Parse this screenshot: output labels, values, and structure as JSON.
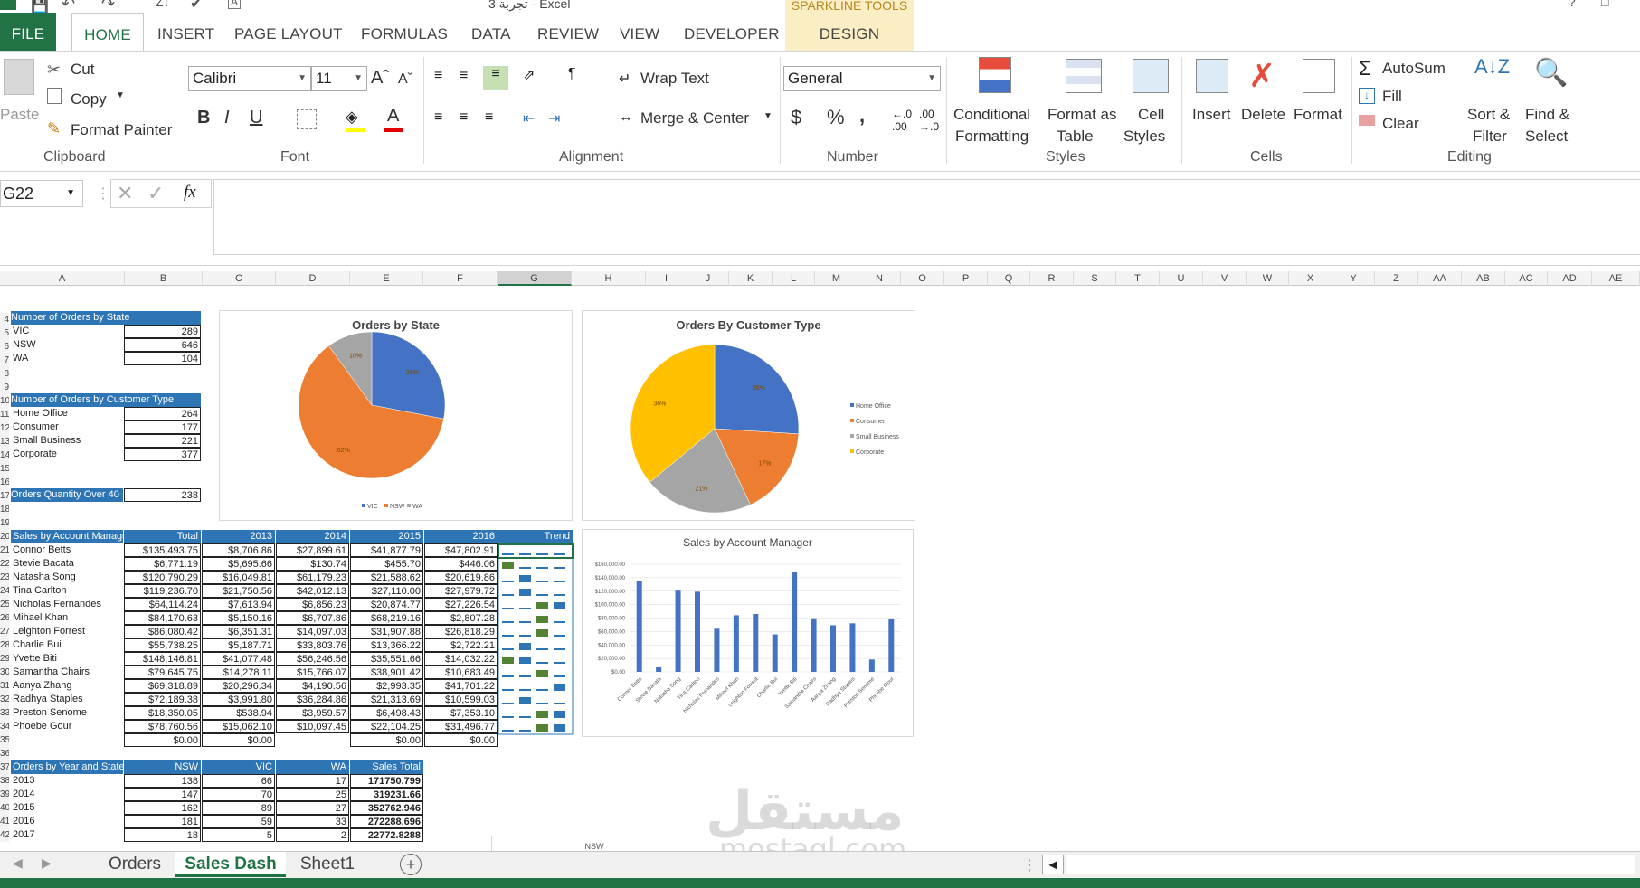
{
  "window": {
    "title": "تجربة 3 - Excel",
    "context_label": "SPARKLINE TOOLS"
  },
  "tabs": [
    "FILE",
    "HOME",
    "INSERT",
    "PAGE LAYOUT",
    "FORMULAS",
    "DATA",
    "REVIEW",
    "VIEW",
    "DEVELOPER"
  ],
  "context_tab": "DESIGN",
  "ribbon": {
    "clipboard": {
      "paste": "Paste",
      "cut": "Cut",
      "copy": "Copy",
      "format_painter": "Format Painter",
      "label": "Clipboard"
    },
    "font": {
      "name": "Calibri",
      "size": "11",
      "bold": "B",
      "italic": "I",
      "underline": "U",
      "label": "Font"
    },
    "alignment": {
      "wrap": "Wrap Text",
      "merge": "Merge & Center",
      "label": "Alignment"
    },
    "number": {
      "format": "General",
      "currency": "$",
      "percent": "%",
      "comma": ",",
      "label": "Number"
    },
    "styles": {
      "cond1": "Conditional",
      "cond2": "Formatting",
      "fmt1": "Format as",
      "fmt2": "Table",
      "cell1": "Cell",
      "cell2": "Styles",
      "label": "Styles"
    },
    "cells": {
      "insert": "Insert",
      "delete": "Delete",
      "format": "Format",
      "label": "Cells"
    },
    "editing": {
      "autosum": "AutoSum",
      "fill": "Fill",
      "clear": "Clear",
      "sort1": "Sort &",
      "sort2": "Filter",
      "find1": "Find &",
      "find2": "Select",
      "label": "Editing"
    }
  },
  "formula_bar": {
    "name_box": "G22",
    "fx": "fx",
    "value": ""
  },
  "columns": [
    "A",
    "B",
    "C",
    "D",
    "E",
    "F",
    "G",
    "H",
    "I",
    "J",
    "K",
    "L",
    "M",
    "N",
    "O",
    "P",
    "Q",
    "R",
    "S",
    "T",
    "U",
    "V",
    "W",
    "X",
    "Y",
    "Z",
    "AA",
    "AB",
    "AC",
    "AD",
    "AE"
  ],
  "tables": {
    "state": {
      "header": "Number of Orders by State",
      "rows": [
        [
          "VIC",
          "289"
        ],
        [
          "NSW",
          "646"
        ],
        [
          "WA",
          "104"
        ]
      ]
    },
    "customer": {
      "header": "Number of Orders by Customer Type",
      "rows": [
        [
          "Home Office",
          "264"
        ],
        [
          "Consumer",
          "177"
        ],
        [
          "Small Business",
          "221"
        ],
        [
          "Corporate",
          "377"
        ]
      ]
    },
    "qty": {
      "label": "Orders Quantity Over 40",
      "value": "238"
    },
    "managers": {
      "headers": [
        "Sales by Account Manager",
        "Total",
        "2013",
        "2014",
        "2015",
        "2016",
        "Trend"
      ],
      "rows": [
        [
          "Connor Betts",
          "$135,493.75",
          "$8,706.86",
          "$27,899.61",
          "$41,877.79",
          "$47,802.91"
        ],
        [
          "Stevie Bacata",
          "$6,771.19",
          "$5,695.66",
          "$130.74",
          "$455.70",
          "$446.06"
        ],
        [
          "Natasha Song",
          "$120,790.29",
          "$16,049.81",
          "$61,179.23",
          "$21,588.62",
          "$20,619.86"
        ],
        [
          "Tina Carlton",
          "$119,236.70",
          "$21,750.56",
          "$42,012.13",
          "$27,110.00",
          "$27,979.72"
        ],
        [
          "Nicholas Fernandes",
          "$64,114.24",
          "$7,613.94",
          "$6,856.23",
          "$20,874.77",
          "$27,226.54"
        ],
        [
          "Mihael Khan",
          "$84,170.63",
          "$5,150.16",
          "$6,707.86",
          "$68,219.16",
          "$2,807.28"
        ],
        [
          "Leighton Forrest",
          "$86,080.42",
          "$6,351.31",
          "$14,097.03",
          "$31,907.88",
          "$26,818.29"
        ],
        [
          "Charlie Bui",
          "$55,738.25",
          "$5,187.71",
          "$33,803.76",
          "$13,366.22",
          "$2,722.21"
        ],
        [
          "Yvette Biti",
          "$148,146.81",
          "$41,077.48",
          "$56,246.56",
          "$35,551.66",
          "$14,032.22"
        ],
        [
          "Samantha Chairs",
          "$79,645.75",
          "$14,278.11",
          "$15,766.07",
          "$38,901.42",
          "$10,683.49"
        ],
        [
          "Aanya Zhang",
          "$69,318.89",
          "$20,296.34",
          "$4,190.56",
          "$2,993.35",
          "$41,701.22"
        ],
        [
          "Radhya Staples",
          "$72,189.38",
          "$3,991.80",
          "$36,284.86",
          "$21,313.69",
          "$10,599.03"
        ],
        [
          "Preston Senome",
          "$18,350.05",
          "$538.94",
          "$3,959.57",
          "$6,498.43",
          "$7,353.10"
        ],
        [
          "Phoebe Gour",
          "$78,760.56",
          "$15,062.10",
          "$10,097.45",
          "$22,104.25",
          "$31,496.77"
        ],
        [
          "",
          "$0.00",
          "$0.00",
          "",
          "$0.00",
          "$0.00"
        ]
      ]
    },
    "year": {
      "headers": [
        "Orders by Year and State",
        "NSW",
        "VIC",
        "WA",
        "Sales Total"
      ],
      "rows": [
        [
          "2013",
          "138",
          "66",
          "17",
          "171750.799"
        ],
        [
          "2014",
          "147",
          "70",
          "25",
          "319231.66"
        ],
        [
          "2015",
          "162",
          "89",
          "27",
          "352762.946"
        ],
        [
          "2016",
          "181",
          "59",
          "33",
          "272288.696"
        ],
        [
          "2017",
          "18",
          "5",
          "2",
          "22772.8288"
        ]
      ]
    }
  },
  "row_numbers": [
    "4",
    "5",
    "6",
    "7",
    "8",
    "9",
    "10",
    "11",
    "12",
    "13",
    "14",
    "15",
    "16",
    "17",
    "18",
    "19",
    "20",
    "21",
    "22",
    "23",
    "24",
    "25",
    "26",
    "27",
    "28",
    "29",
    "30",
    "31",
    "32",
    "33",
    "34",
    "35",
    "36",
    "37",
    "38",
    "39",
    "40",
    "41",
    "42"
  ],
  "chart_data": [
    {
      "type": "pie",
      "title": "Orders by State",
      "categories": [
        "VIC",
        "NSW",
        "WA"
      ],
      "values": [
        28,
        62,
        10
      ],
      "labels": [
        "28%",
        "62%",
        "10%"
      ],
      "colors": [
        "#4472c4",
        "#ed7d31",
        "#a5a5a5"
      ],
      "legend": "bottom"
    },
    {
      "type": "pie",
      "title": "Orders By Customer Type",
      "categories": [
        "Home Office",
        "Consumer",
        "Small Business",
        "Corporate"
      ],
      "values": [
        26,
        17,
        21,
        36
      ],
      "labels": [
        "26%",
        "17%",
        "21%",
        "36%"
      ],
      "colors": [
        "#4472c4",
        "#ed7d31",
        "#a5a5a5",
        "#ffc000"
      ],
      "legend": "right"
    },
    {
      "type": "bar",
      "title": "Sales by Account Manager",
      "categories": [
        "Connor Betts",
        "Stevie Bacata",
        "Natasha Song",
        "Tina Carlton",
        "Nicholas Fernandes",
        "Mihael Khan",
        "Leighton Forrest",
        "Charlie Bui",
        "Yvette Biti",
        "Samantha Chairs",
        "Aanya Zhang",
        "Radhya Staples",
        "Preston Senome",
        "Phoebe Gour"
      ],
      "values": [
        135493.75,
        6771.19,
        120790.29,
        119236.7,
        64114.24,
        84170.63,
        86080.42,
        55738.25,
        148146.81,
        79645.75,
        69318.89,
        72189.38,
        18350.05,
        78760.56
      ],
      "ylim": [
        0,
        160000
      ],
      "yticks": [
        "$0.00",
        "$20,000.00",
        "$40,000.00",
        "$60,000.00",
        "$80,000.00",
        "$100,000.00",
        "$120,000.00",
        "$140,000.00",
        "$160,000.00"
      ],
      "color": "#4472c4"
    }
  ],
  "sparkline_trend": [
    [
      0,
      0,
      0,
      0
    ],
    [
      1,
      0,
      0,
      0
    ],
    [
      0,
      1,
      0,
      0
    ],
    [
      0,
      1,
      0,
      0
    ],
    [
      0,
      0,
      1,
      1
    ],
    [
      0,
      0,
      1,
      0
    ],
    [
      0,
      0,
      1,
      0
    ],
    [
      0,
      1,
      0,
      0
    ],
    [
      1,
      1,
      0,
      0
    ],
    [
      0,
      0,
      1,
      0
    ],
    [
      0,
      0,
      0,
      1
    ],
    [
      0,
      1,
      0,
      0
    ],
    [
      0,
      0,
      1,
      1
    ],
    [
      0,
      0,
      1,
      1
    ]
  ],
  "bottom_chart_label": "NSW",
  "sheet_tabs": [
    "Orders",
    "Sales Dash",
    "Sheet1"
  ],
  "active_sheet": "Sales Dash",
  "watermark": {
    "arabic": "مستقل",
    "latin": "mostaql.com"
  }
}
